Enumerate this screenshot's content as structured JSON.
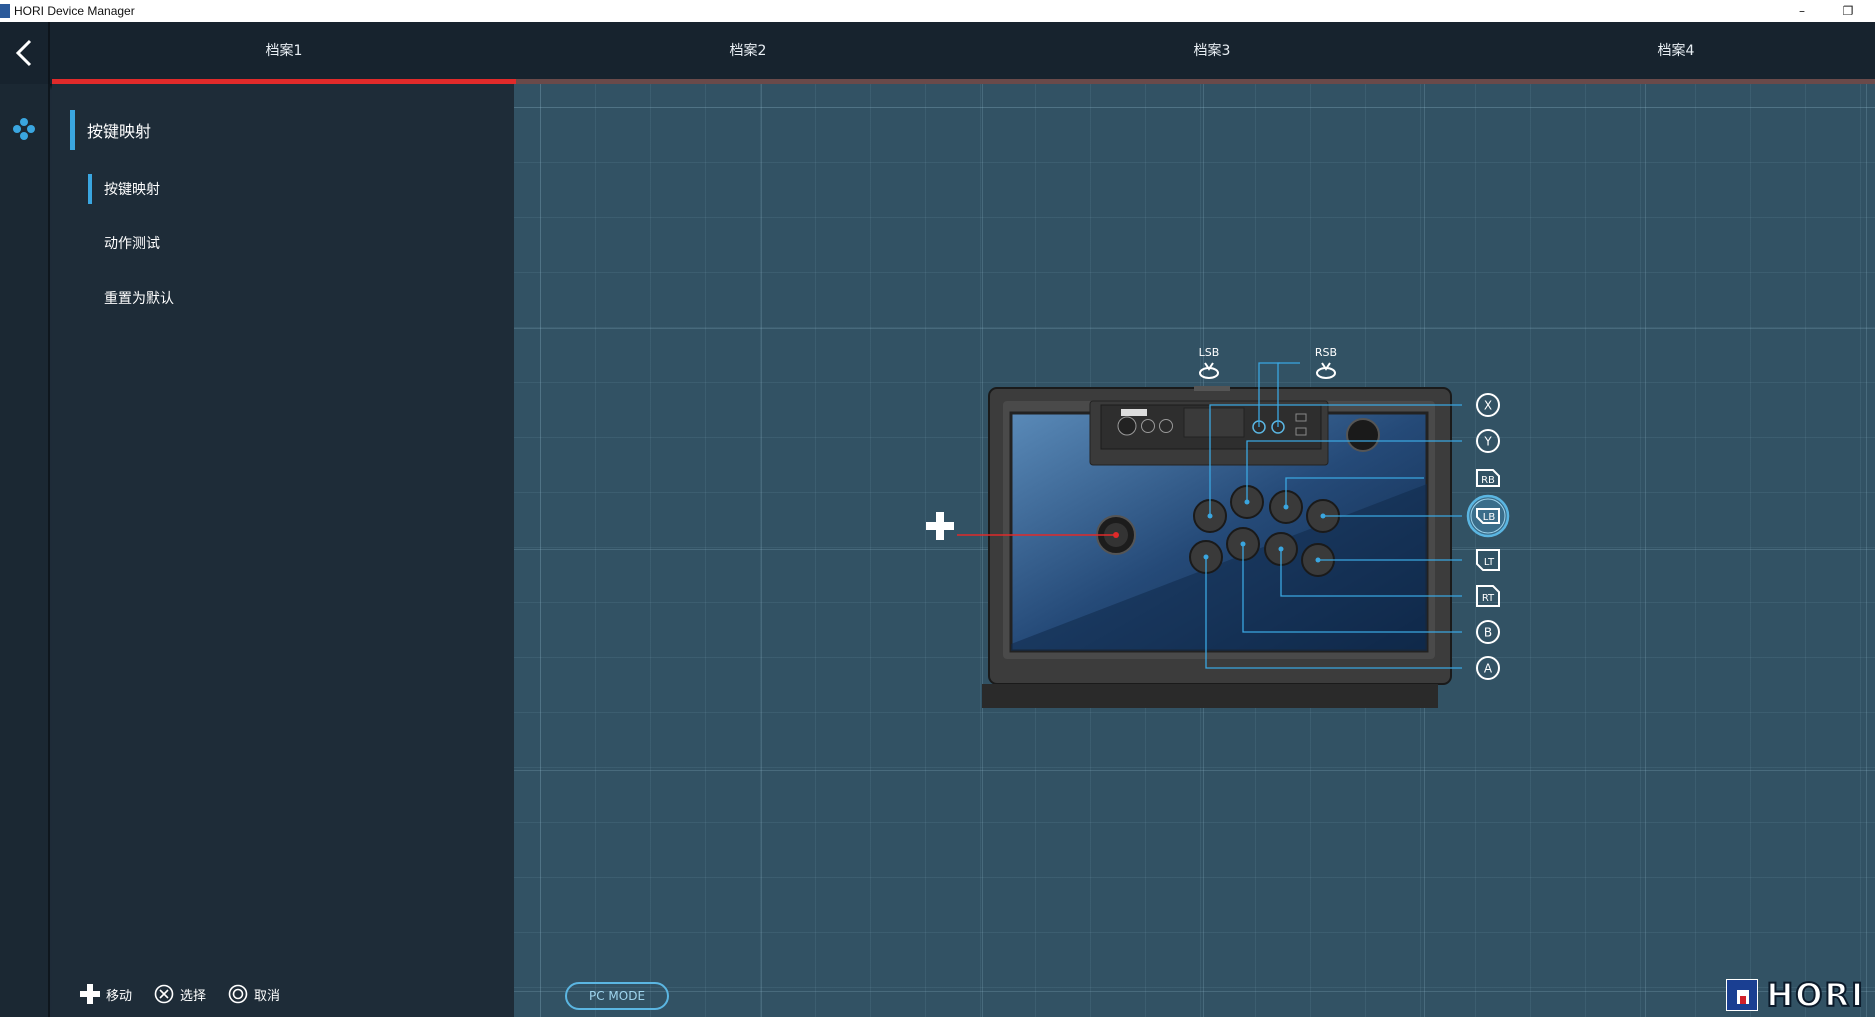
{
  "window": {
    "title": "HORI Device Manager",
    "minimize": "–",
    "restore": "❐"
  },
  "tabs": [
    {
      "label": "档案1",
      "active": true
    },
    {
      "label": "档案2",
      "active": false
    },
    {
      "label": "档案3",
      "active": false
    },
    {
      "label": "档案4",
      "active": false
    }
  ],
  "colors": {
    "accent_red": "#e02a2a",
    "accent_blue": "#3aa6e0",
    "inactive_tab": "#6a4a4a"
  },
  "rail": {
    "icon": "dpad-cluster-icon"
  },
  "sidebar": {
    "section_title": "按键映射",
    "items": [
      {
        "label": "按键映射",
        "selected": true
      },
      {
        "label": "动作测试",
        "selected": false
      },
      {
        "label": "重置为默认",
        "selected": false
      }
    ]
  },
  "hints": [
    {
      "icon": "dpad-icon",
      "label": "移动"
    },
    {
      "icon": "cross-circle-icon",
      "label": "选择"
    },
    {
      "icon": "circle-circle-icon",
      "label": "取消"
    }
  ],
  "controller": {
    "top_labels": {
      "lsb": "LSB",
      "rsb": "RSB"
    },
    "buttons": [
      {
        "id": "x",
        "label": "X"
      },
      {
        "id": "y",
        "label": "Y"
      },
      {
        "id": "rb",
        "label": "RB"
      },
      {
        "id": "lb",
        "label": "LB",
        "selected": true
      },
      {
        "id": "lt",
        "label": "LT"
      },
      {
        "id": "rt",
        "label": "RT"
      },
      {
        "id": "b",
        "label": "B"
      },
      {
        "id": "a",
        "label": "A"
      }
    ]
  },
  "mode_button": "PC MODE",
  "brand": "HORI"
}
